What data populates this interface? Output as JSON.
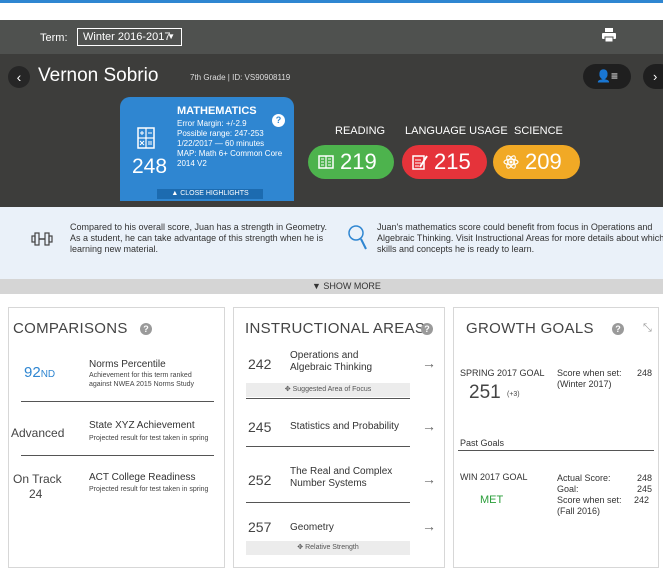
{
  "header": {
    "term_label": "Term:",
    "term_value": "Winter 2016-2017"
  },
  "student": {
    "name": "Vernon Sobrio",
    "meta": "7th Grade  |  ID: VS90908119"
  },
  "math_card": {
    "title": "MATHEMATICS",
    "lines": [
      "Error Margin: +/-2.9",
      "Possible range: 247-253",
      "1/22/2017 — 60 minutes",
      "MAP: Math 6+ Common Core",
      "2014 V2"
    ],
    "score": "248",
    "close_label": "▲ CLOSE HIGHLIGHTS",
    "info": "?"
  },
  "subjects": [
    {
      "label": "READING",
      "score": "219",
      "color": "#4db34d"
    },
    {
      "label": "LANGUAGE USAGE",
      "score": "215",
      "color": "#e5333a"
    },
    {
      "label": "SCIENCE",
      "score": "209",
      "color": "#f1a925"
    }
  ],
  "highlights": {
    "left_lines": [
      "Compared to his overall score, Juan has a strength in Geometry.",
      "As a student, he can take advantage of this strength when he is",
      "learning new material."
    ],
    "right_lines": [
      "Juan's mathematics score could benefit from focus in Operations and",
      "Algebraic Thinking. Visit Instructional Areas for more details about which",
      "skills and concepts he is ready to learn."
    ],
    "show_more": "▼  SHOW MORE"
  },
  "comparisons": {
    "title": "COMPARISONS",
    "percentile_num": "92",
    "percentile_suffix": "ND",
    "rows": [
      {
        "value": "",
        "title": "Norms Percentile",
        "sub": [
          "Achievement  for this term ranked",
          "against NWEA 2015 Norms Study"
        ]
      },
      {
        "value": "Advanced",
        "title": "State XYZ Achievement",
        "sub": [
          "Projected result for test taken in spring"
        ]
      },
      {
        "value": "On Track",
        "value2": "24",
        "title": "ACT College Readiness",
        "sub": [
          "Projected result for test taken in spring"
        ]
      }
    ]
  },
  "instructional": {
    "title": "INSTRUCTIONAL AREAS",
    "areas": [
      {
        "score": "242",
        "name_lines": [
          "Operations and",
          "Algebraic Thinking"
        ],
        "tag": "Suggested Area of Focus"
      },
      {
        "score": "245",
        "name_lines": [
          "Statistics and Probability"
        ]
      },
      {
        "score": "252",
        "name_lines": [
          "The Real and Complex",
          "Number Systems"
        ]
      },
      {
        "score": "257",
        "name_lines": [
          "Geometry"
        ],
        "tag": "Relative Strength"
      }
    ]
  },
  "growth": {
    "title": "GROWTH GOALS",
    "goal_label": "SPRING 2017 GOAL",
    "goal_value": "251",
    "goal_delta": "(+3)",
    "when_set_label": "Score when set:",
    "when_set_value": "248",
    "when_set_term": "(Winter 2017)",
    "past_label": "Past Goals",
    "past_goal_label": "WIN 2017 GOAL",
    "past_status": "MET",
    "past_rows": [
      {
        "label": "Actual Score:",
        "value": "248"
      },
      {
        "label": "Goal:",
        "value": "245"
      },
      {
        "label": "Score when set:",
        "value": "242"
      }
    ],
    "past_term": "(Fall 2016)"
  }
}
